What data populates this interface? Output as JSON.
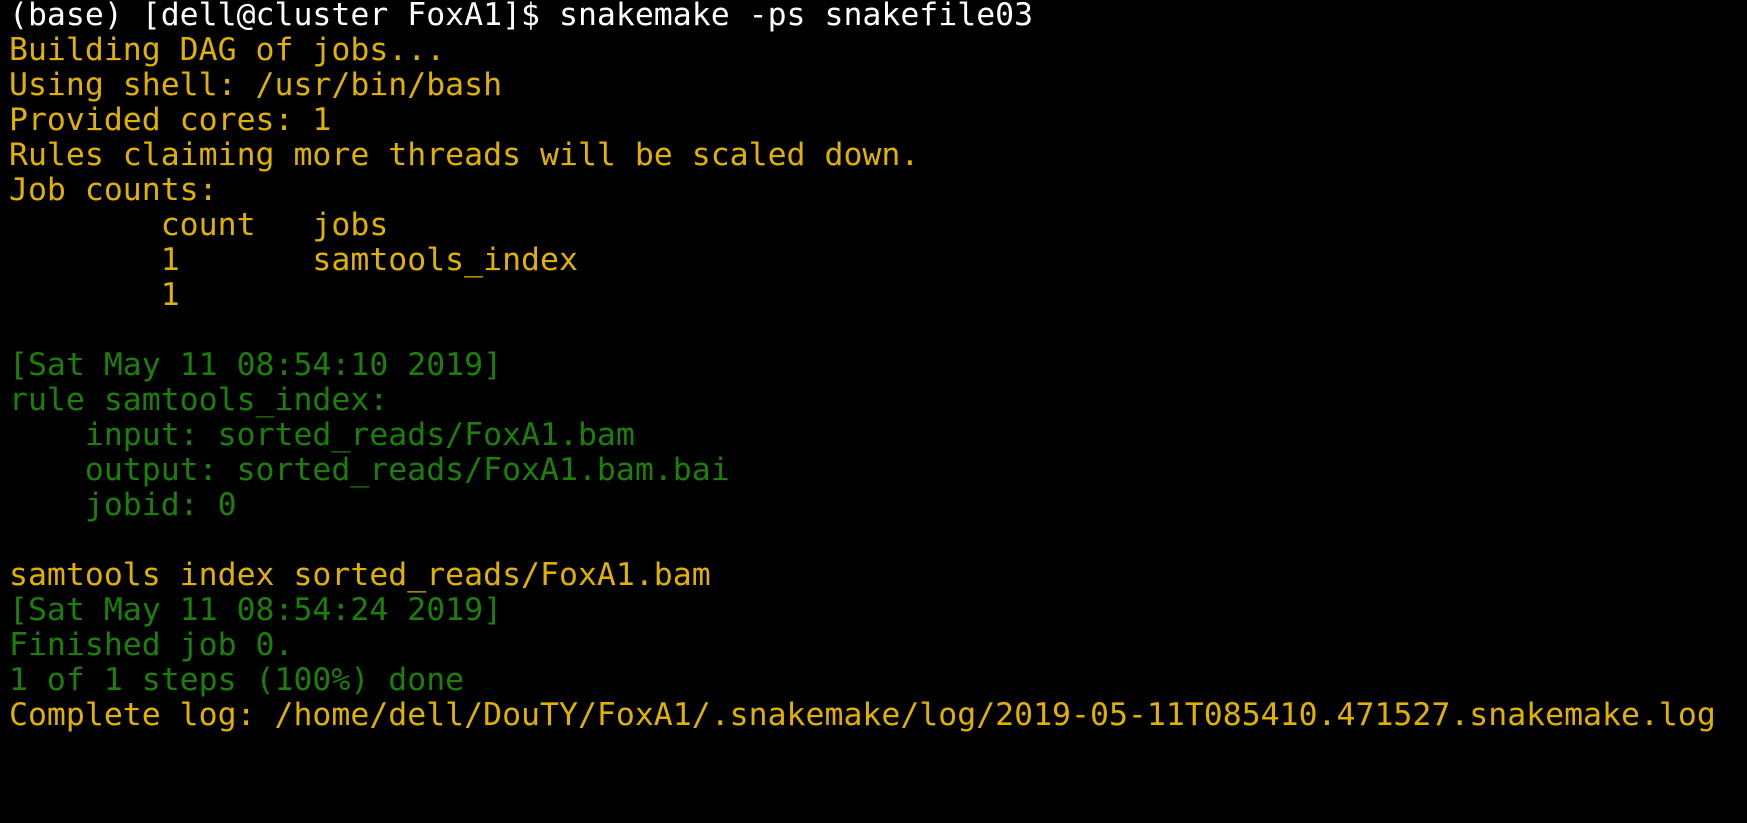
{
  "terminal": {
    "colors": {
      "background": "#000000",
      "prompt": "#ffffff",
      "info": "#e1b100",
      "success": "#1c7f0a"
    },
    "prompt_line": "(base) [dell@cluster FoxA1]$ snakemake -ps snakefile03",
    "output": {
      "building": "Building DAG of jobs...",
      "shell": "Using shell: /usr/bin/bash",
      "cores": "Provided cores: 1",
      "scaled": "Rules claiming more threads will be scaled down.",
      "job_counts": "Job counts:",
      "count_header": "        count   jobs",
      "count_row_1": "        1       samtools_index",
      "count_total": "        1",
      "timestamp_start": "[Sat May 11 08:54:10 2019]",
      "rule_line": "rule samtools_index:",
      "input_line": "    input: sorted_reads/FoxA1.bam",
      "output_line": "    output: sorted_reads/FoxA1.bam.bai",
      "jobid_line": "    jobid: 0",
      "command_line": "samtools index sorted_reads/FoxA1.bam",
      "timestamp_end": "[Sat May 11 08:54:24 2019]",
      "finished": "Finished job 0.",
      "steps": "1 of 1 steps (100%) done",
      "log": "Complete log: /home/dell/DouTY/FoxA1/.snakemake/log/2019-05-11T085410.471527.snakemake.log"
    }
  }
}
